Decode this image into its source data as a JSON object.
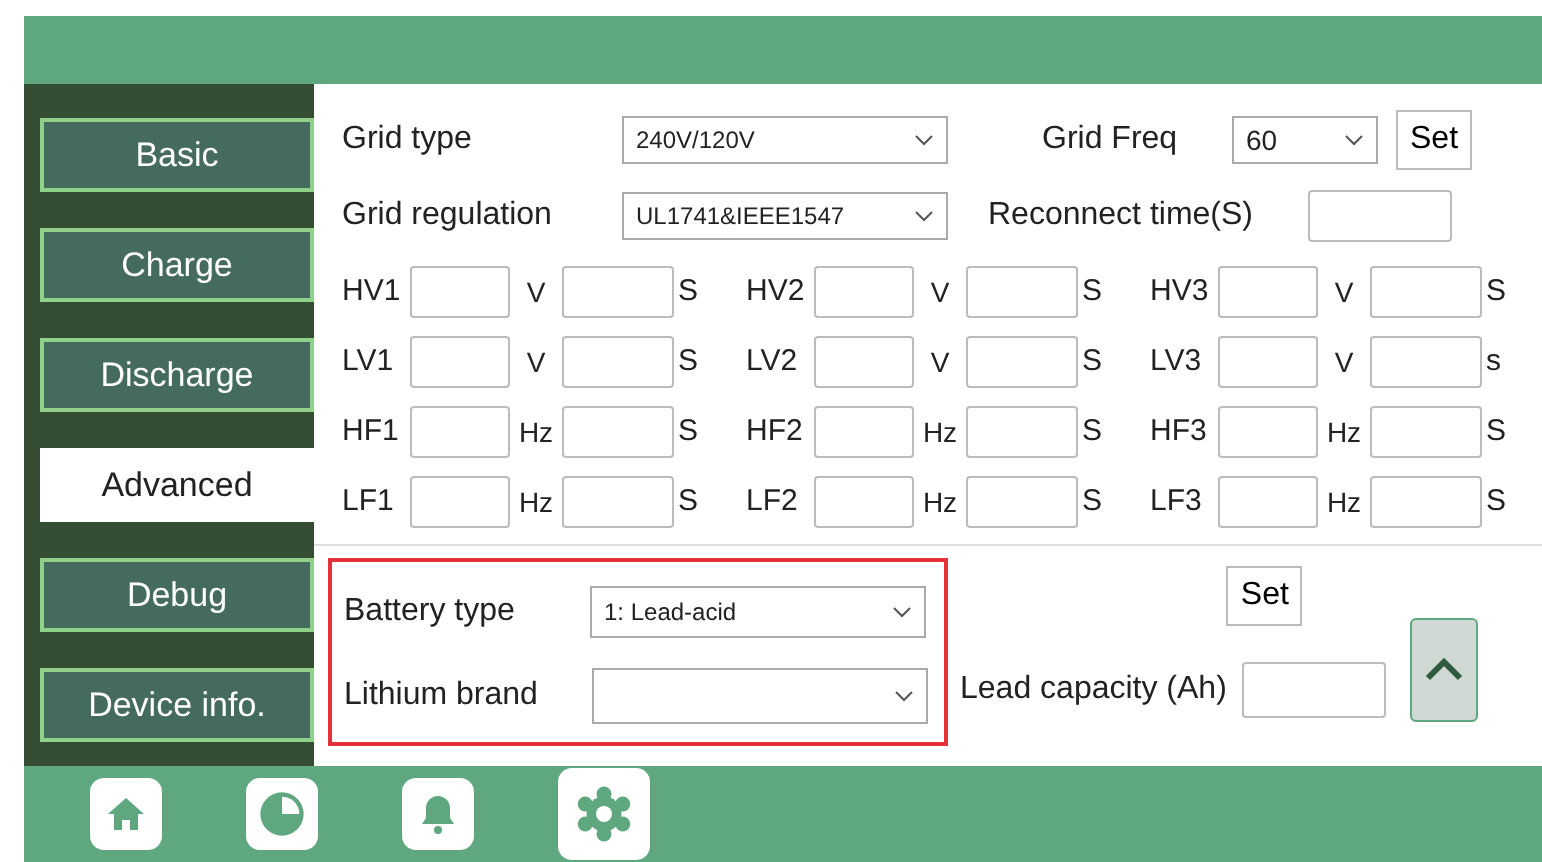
{
  "sidebar": {
    "items": [
      {
        "label": "Basic",
        "selected": false
      },
      {
        "label": "Charge",
        "selected": false
      },
      {
        "label": "Discharge",
        "selected": false
      },
      {
        "label": "Advanced",
        "selected": true
      },
      {
        "label": "Debug",
        "selected": false
      },
      {
        "label": "Device info.",
        "selected": false
      }
    ]
  },
  "grid": {
    "type_label": "Grid type",
    "type_value": "240V/120V",
    "freq_label": "Grid Freq",
    "freq_value": "60",
    "set_button": "Set",
    "regulation_label": "Grid regulation",
    "regulation_value": "UL1741&IEEE1547",
    "reconnect_label": "Reconnect time(S)"
  },
  "protection_rows": [
    [
      {
        "label": "HV1",
        "unit": "V",
        "time_unit": "S"
      },
      {
        "label": "HV2",
        "unit": "V",
        "time_unit": "S"
      },
      {
        "label": "HV3",
        "unit": "V",
        "time_unit": "S"
      }
    ],
    [
      {
        "label": "LV1",
        "unit": "V",
        "time_unit": "S"
      },
      {
        "label": "LV2",
        "unit": "V",
        "time_unit": "S"
      },
      {
        "label": "LV3",
        "unit": "V",
        "time_unit": "s"
      }
    ],
    [
      {
        "label": "HF1",
        "unit": "Hz",
        "time_unit": "S"
      },
      {
        "label": "HF2",
        "unit": "Hz",
        "time_unit": "S"
      },
      {
        "label": "HF3",
        "unit": "Hz",
        "time_unit": "S"
      }
    ],
    [
      {
        "label": "LF1",
        "unit": "Hz",
        "time_unit": "S"
      },
      {
        "label": "LF2",
        "unit": "Hz",
        "time_unit": "S"
      },
      {
        "label": "LF3",
        "unit": "Hz",
        "time_unit": "S"
      }
    ]
  ],
  "battery": {
    "type_label": "Battery  type",
    "type_value": "1: Lead-acid",
    "brand_label": "Lithium  brand",
    "set_button": "Set",
    "capacity_label": "Lead capacity (Ah)"
  },
  "nav": [
    {
      "kind": "home",
      "selected": false
    },
    {
      "kind": "chart",
      "selected": false
    },
    {
      "kind": "bell",
      "selected": false
    },
    {
      "kind": "gear",
      "selected": true
    }
  ]
}
